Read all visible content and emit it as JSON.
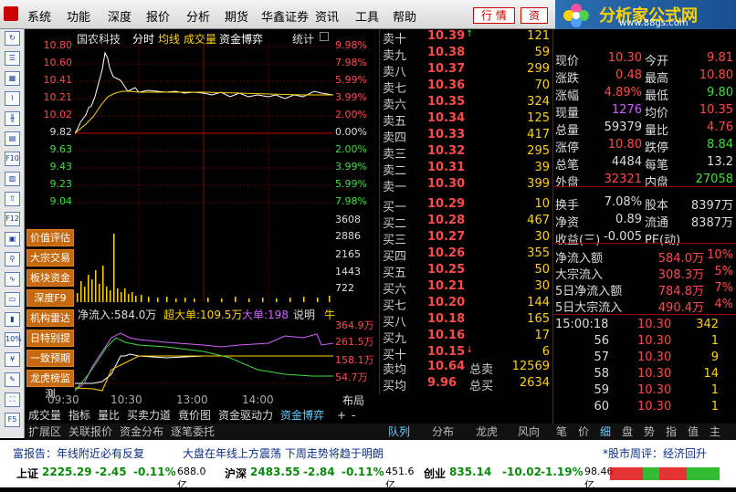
{
  "menu": {
    "items": [
      "系统",
      "功能",
      "深度",
      "报价",
      "分析",
      "期货",
      "华鑫证券",
      "资讯",
      "工具",
      "帮助"
    ],
    "tabs": [
      "行 情",
      "资"
    ]
  },
  "logo": {
    "title": "分析家公式网",
    "url": "www.88gs.com"
  },
  "header": {
    "stock": "国农科技",
    "tabs": [
      "分时",
      "均线",
      "成交量",
      "资金博弈"
    ],
    "stats_label": "统计"
  },
  "left_prices": [
    "10.80",
    "10.60",
    "10.41",
    "10.21",
    "10.02",
    "9.82",
    "9.63",
    "9.43",
    "9.23",
    "9.04"
  ],
  "right_pcts": [
    "9.98%",
    "7.98%",
    "5.99%",
    "3.99%",
    "2.00%",
    "0.00%",
    "2.00%",
    "3.99%",
    "5.99%",
    "7.98%"
  ],
  "volume_axis": [
    "3608",
    "2886",
    "2165",
    "1443",
    "722"
  ],
  "side_buttons": [
    "价值评估",
    "大宗交易",
    "板块资金",
    "深度F9",
    "机构雷达",
    "日特别提",
    "一致预期",
    "龙虎榜监测"
  ],
  "flow": {
    "net_label": "净流入:584.0万",
    "big_label": "超大单:109.5万",
    "large_label": "大单:198",
    "explain": "说明",
    "extra": "牛"
  },
  "flow_axis": [
    "364.9万",
    "261.5万",
    "158.1万",
    "54.7万"
  ],
  "times": [
    "09:30",
    "10:30",
    "13:00",
    "14:00"
  ],
  "bottom_tabs": [
    "成交量",
    "指标",
    "量比",
    "买卖力道",
    "竟价图",
    "资金驱动力",
    "资金博弈",
    "+",
    "-",
    "布局"
  ],
  "bottom_tabs2": [
    "扩展区",
    "关联报价",
    "资金分布",
    "逐笔委托",
    "队列",
    "分布",
    "龙虎",
    "风向",
    "笔",
    "价",
    "细",
    "盘",
    "势",
    "指",
    "值",
    "主"
  ],
  "order_book": [
    {
      "name": "卖十",
      "price": "10.39",
      "vol": "121",
      "mark": "↑"
    },
    {
      "name": "卖九",
      "price": "10.38",
      "vol": "59"
    },
    {
      "name": "卖八",
      "price": "10.37",
      "vol": "299"
    },
    {
      "name": "卖七",
      "price": "10.36",
      "vol": "70"
    },
    {
      "name": "卖六",
      "price": "10.35",
      "vol": "324"
    },
    {
      "name": "卖五",
      "price": "10.34",
      "vol": "125"
    },
    {
      "name": "卖四",
      "price": "10.33",
      "vol": "417"
    },
    {
      "name": "卖三",
      "price": "10.32",
      "vol": "295"
    },
    {
      "name": "卖二",
      "price": "10.31",
      "vol": "39"
    },
    {
      "name": "卖一",
      "price": "10.30",
      "vol": "399"
    },
    {
      "name": "买一",
      "price": "10.29",
      "vol": "10"
    },
    {
      "name": "买二",
      "price": "10.28",
      "vol": "467"
    },
    {
      "name": "买三",
      "price": "10.27",
      "vol": "30"
    },
    {
      "name": "买四",
      "price": "10.26",
      "vol": "355"
    },
    {
      "name": "买五",
      "price": "10.25",
      "vol": "50"
    },
    {
      "name": "买六",
      "price": "10.21",
      "vol": "30"
    },
    {
      "name": "买七",
      "price": "10.20",
      "vol": "144"
    },
    {
      "name": "买八",
      "price": "10.18",
      "vol": "165"
    },
    {
      "name": "买九",
      "price": "10.16",
      "vol": "17"
    },
    {
      "name": "买十",
      "price": "10.15",
      "vol": "6",
      "mark": "↓"
    }
  ],
  "book_avg": {
    "sell_avg_label": "卖均",
    "sell_avg": "10.64",
    "total_sell_label": "总卖",
    "total_sell": "12569",
    "buy_avg_label": "买均",
    "buy_avg": "9.96",
    "total_buy_label": "总买",
    "total_buy": "2634"
  },
  "quote": [
    [
      "现价",
      "10.30",
      "今开",
      "9.81"
    ],
    [
      "涨跌",
      "0.48",
      "最高",
      "10.80"
    ],
    [
      "涨幅",
      "4.89%",
      "最低",
      "9.80"
    ],
    [
      "现量",
      "1276",
      "均价",
      "10.35"
    ],
    [
      "总量",
      "59379",
      "量比",
      "4.76"
    ],
    [
      "涨停",
      "10.80",
      "跌停",
      "8.84"
    ],
    [
      "总笔",
      "4484",
      "每笔",
      "13.2"
    ],
    [
      "外盘",
      "32321",
      "内盘",
      "27058"
    ],
    [
      "换手",
      "7.08%",
      "股本",
      "8397万"
    ],
    [
      "净资",
      "0.89",
      "流通",
      "8387万"
    ],
    [
      "收益(三)",
      "-0.005",
      "PE(动)",
      ""
    ]
  ],
  "flows": [
    [
      "净流入额",
      "584.0万",
      "10%"
    ],
    [
      "大宗流入",
      "308.3万",
      "5%"
    ],
    [
      "5日净流入额",
      "784.8万",
      "7%"
    ],
    [
      "5日大宗流入",
      "490.4万",
      "4%"
    ]
  ],
  "ticks": [
    [
      "15:00:18",
      "10.30",
      "342"
    ],
    [
      "56",
      "10.30",
      "1"
    ],
    [
      "57",
      "10.30",
      "9"
    ],
    [
      "58",
      "10.30",
      "14"
    ],
    [
      "59",
      "10.30",
      "1"
    ],
    [
      "60",
      "10.30",
      "1"
    ]
  ],
  "news": {
    "left": "富报告：年线附近必有反复",
    "mid": "大盘在年线上方震荡 下周走势将趋于明朗",
    "right": "*股市周评：经济回升"
  },
  "indices": [
    {
      "name": "上证",
      "value": "2225.29",
      "chg": "-2.45",
      "pct": "-0.11%",
      "amt": "688.0亿"
    },
    {
      "name": "沪深",
      "value": "2483.55",
      "chg": "-2.84",
      "pct": "-0.11%",
      "amt": "451.6亿"
    },
    {
      "name": "创业",
      "value": "835.14",
      "chg": "-10.02",
      "pct": "-1.19%",
      "amt": "98.46亿"
    }
  ],
  "colors": {
    "up": "#ff4a4a",
    "down": "#3fdc3f",
    "neutral": "#dddddd",
    "accent": "#ffd200"
  }
}
